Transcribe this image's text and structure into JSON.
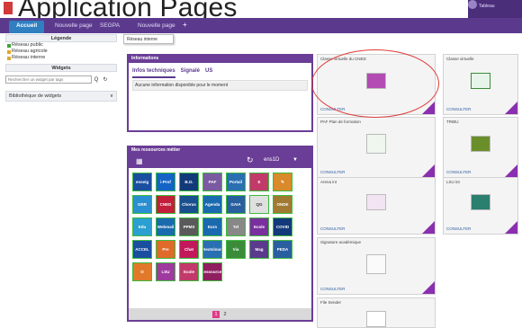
{
  "header": {
    "caption": "Application Pages",
    "user_label": "Tableau"
  },
  "nav": {
    "tabs": [
      {
        "label": "Accueil",
        "active": true
      },
      {
        "label": "Nouvelle page"
      },
      {
        "label": "SEGPA"
      },
      {
        "label": "Nouvelle page"
      }
    ],
    "add_label": "+"
  },
  "dropdown": {
    "item": "Réseau interne"
  },
  "left": {
    "legend_title": "Légende",
    "legend": [
      {
        "label": "Réseau public",
        "color": "#3aa63a"
      },
      {
        "label": "Réseau agricole",
        "color": "#e0a72a"
      },
      {
        "label": "Réseau interne",
        "color": "#d8a83a"
      }
    ],
    "widgets_title": "Widgets",
    "search_placeholder": "Rechercher un widget par tags",
    "search_icon": "Q",
    "biblio_label": "Bibliothèque de widgets",
    "biblio_caret": "∨"
  },
  "info": {
    "title": "Informations",
    "tabs": [
      "Infos techniques",
      "Signalé",
      "US"
    ],
    "message": "Aucune information disponible pour le moment"
  },
  "resources": {
    "title": "Mes ressources métier",
    "selector": "ens1D",
    "tiles": [
      "enseig",
      "i-Prof",
      "B.O.",
      "PAF",
      "Portail",
      "E",
      "✎",
      "GRR",
      "CNED",
      "Chorus",
      "Agenda",
      "GAIA",
      "QG",
      "ONDE",
      "Edu",
      "Webmail",
      "PPMS",
      "Euro",
      "Tel",
      "Ecole",
      "COVID",
      "ACCEL",
      "Pre",
      "Chat",
      "Nextcloud",
      "Via",
      "Mag",
      "PEDA",
      "O",
      "LSU",
      "Ecole",
      "Ressources",
      "",
      "",
      ""
    ],
    "pages": [
      "1",
      "2"
    ]
  },
  "apps": [
    {
      "title": "Classe virtuelle du CNED",
      "button": "CONSULTER"
    },
    {
      "title": "Classe virtuelle",
      "button": "CONSULTER"
    },
    {
      "title": "PAF Plan de formation",
      "button": "CONSULTER"
    },
    {
      "title": "TRIBU",
      "button": "CONSULTER"
    },
    {
      "title": "Arena int",
      "button": "CONSULTER"
    },
    {
      "title": "LSU int",
      "button": "CONSULTER"
    },
    {
      "title": "Signature académique",
      "button": "CONSULTER"
    },
    {
      "title": "File Sender",
      "button": ""
    }
  ]
}
